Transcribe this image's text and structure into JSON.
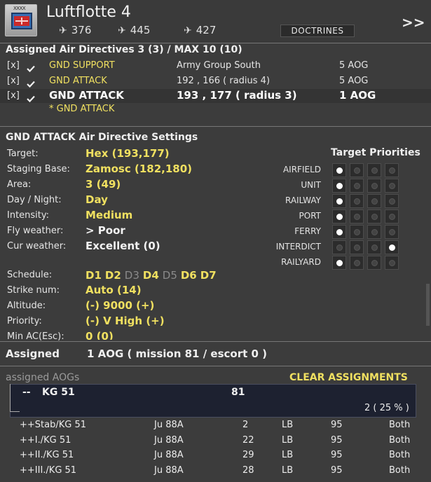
{
  "header": {
    "title": "Luftflotte 4",
    "badge_text": "XXXX",
    "stats": [
      "376",
      "445",
      "427"
    ],
    "doctrines_label": "DOCTRINES",
    "forward_label": ">>"
  },
  "directives": {
    "heading": "Assigned Air Directives 3 (3) / MAX 10 (10)",
    "rows": [
      {
        "mark": "[x]",
        "type": "GND SUPPORT",
        "target": "Army Group South",
        "aog": "5 AOG"
      },
      {
        "mark": "[x]",
        "type": "GND ATTACK",
        "target": "192 , 166 ( radius 4)",
        "aog": "5 AOG"
      },
      {
        "mark": "[x]",
        "type": "GND ATTACK",
        "target": "193 , 177 ( radius 3)",
        "aog": "1 AOG"
      }
    ],
    "new_item": "* GND ATTACK"
  },
  "settings": {
    "heading": "GND ATTACK Air Directive Settings",
    "fields": [
      {
        "label": "Target:",
        "value": "Hex (193,177)"
      },
      {
        "label": "Staging Base:",
        "value": "Zamosc (182,180)"
      },
      {
        "label": "Area:",
        "value": "3 (49)"
      },
      {
        "label": "Day / Night:",
        "value": "Day"
      },
      {
        "label": "Intensity:",
        "value": "Medium"
      },
      {
        "label": "Fly weather:",
        "value": "> Poor"
      },
      {
        "label": "Cur weather:",
        "value": "Excellent (0)"
      }
    ],
    "schedule_label": "Schedule:",
    "schedule_days": [
      {
        "day": "D1",
        "active": true
      },
      {
        "day": "D2",
        "active": true
      },
      {
        "day": "D3",
        "active": false
      },
      {
        "day": "D4",
        "active": true
      },
      {
        "day": "D5",
        "active": false
      },
      {
        "day": "D6",
        "active": true
      },
      {
        "day": "D7",
        "active": true
      }
    ],
    "fields2": [
      {
        "label": "Strike num:",
        "value": "Auto (14)"
      },
      {
        "label": "Altitude:",
        "value": "(-) 9000 (+)"
      },
      {
        "label": "Priority:",
        "value": "(-) V High (+)"
      },
      {
        "label": "Min AC(Esc):",
        "value": "0 (0)"
      }
    ]
  },
  "priorities": {
    "heading": "Target Priorities",
    "rows": [
      {
        "label": "AIRFIELD",
        "selected": 1
      },
      {
        "label": "UNIT",
        "selected": 1
      },
      {
        "label": "RAILWAY",
        "selected": 1
      },
      {
        "label": "PORT",
        "selected": 1
      },
      {
        "label": "FERRY",
        "selected": 1
      },
      {
        "label": "INTERDICT",
        "selected": 4
      },
      {
        "label": "RAILYARD",
        "selected": 1
      }
    ]
  },
  "assigned": {
    "label": "Assigned",
    "value": "1 AOG  ( mission 81 / escort 0 )"
  },
  "aogs": {
    "heading": "assigned AOGs",
    "clear_label": "CLEAR ASSIGNMENTS",
    "group": {
      "prefix": "--",
      "name": "KG 51",
      "mission": "81",
      "summary": "2  ( 25 % )"
    },
    "units": [
      {
        "name": "++Stab/KG 51",
        "aircraft": "Ju 88A",
        "count": "2",
        "role": "LB",
        "pct": "95",
        "mode": "Both"
      },
      {
        "name": "++I./KG 51",
        "aircraft": "Ju 88A",
        "count": "22",
        "role": "LB",
        "pct": "95",
        "mode": "Both"
      },
      {
        "name": "++II./KG 51",
        "aircraft": "Ju 88A",
        "count": "29",
        "role": "LB",
        "pct": "95",
        "mode": "Both"
      },
      {
        "name": "++III./KG 51",
        "aircraft": "Ju 88A",
        "count": "28",
        "role": "LB",
        "pct": "95",
        "mode": "Both"
      }
    ]
  },
  "colors": {
    "highlight": "#f0e060",
    "background": "#3c3c3c",
    "group_box": "#1d2130"
  }
}
